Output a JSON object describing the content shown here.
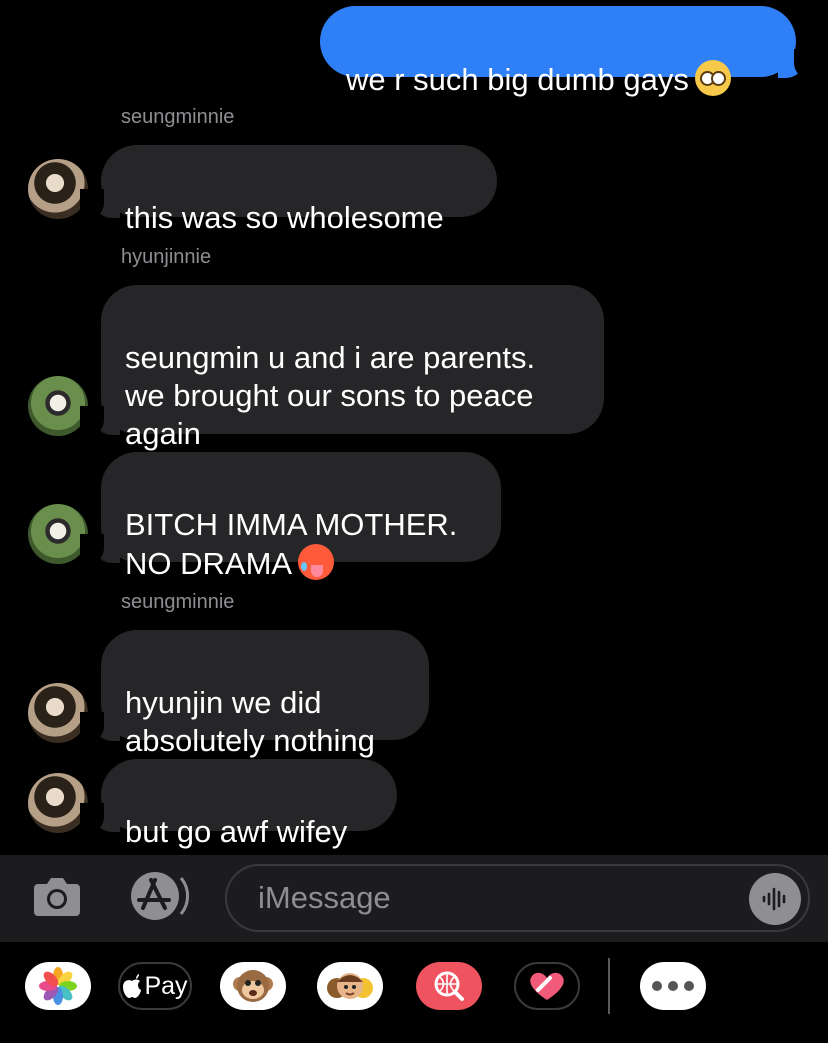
{
  "thread": {
    "outgoing": [
      {
        "text": "we r such big dumb gays",
        "emoji": "pleading-face-emoji"
      }
    ],
    "groups": [
      {
        "sender": "seungminnie",
        "messages": [
          "this was so wholesome"
        ]
      },
      {
        "sender": "hyunjinnie",
        "messages": [
          "seungmin u and i are parents.\nwe brought our sons to peace\nagain",
          "BITCH IMMA MOTHER.\nNO DRAMA"
        ]
      },
      {
        "sender": "seungminnie",
        "messages": [
          "hyunjin we did\nabsolutely nothing",
          "but go awf wifey"
        ]
      }
    ]
  },
  "input": {
    "placeholder": "iMessage"
  },
  "apps_strip": {
    "items": [
      "photos-app",
      "apple-pay-app",
      "animoji-app",
      "memoji-stickers-app",
      "images-search-app",
      "digital-touch-app",
      "more-apps"
    ],
    "apple_pay_label": "Pay"
  },
  "colors": {
    "outgoing_bubble": "#2f80f7",
    "incoming_bubble": "#262628",
    "background": "#000000"
  }
}
